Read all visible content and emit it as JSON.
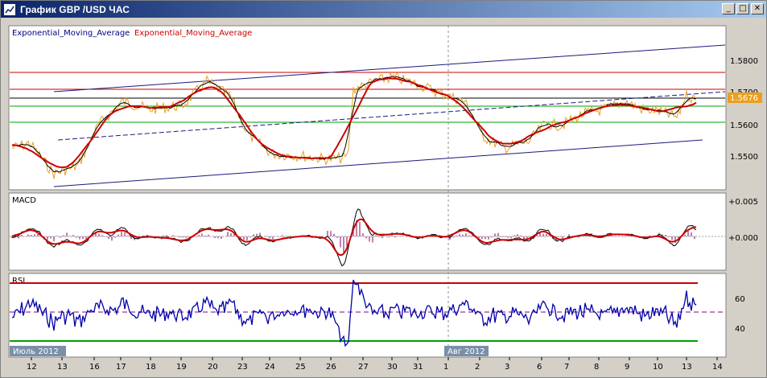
{
  "window": {
    "title": "График GBP /USD  ЧАС",
    "minimize_glyph": "_",
    "maximize_glyph": "□",
    "close_glyph": "✕",
    "icon": "chart-app-icon"
  },
  "colors": {
    "ema_fast": "#000000",
    "ema_slow": "#cc0000",
    "price": "#e8a020",
    "channel": "#1a1a7a",
    "level_red": "#cc0000",
    "level_green": "#00a000",
    "macd_hist": "#800060",
    "rsi_line": "#0000aa",
    "current_price_bg": "#e8a020"
  },
  "chart": {
    "legend_1": "Exponential_Moving_Average",
    "legend_2": "Exponential_Moving_Average",
    "current_price": "1.5676",
    "price_ticks": [
      "1.5800",
      "1.5700",
      "1.5600",
      "1.5500"
    ],
    "macd_title": "MACD",
    "macd_ticks": [
      "+0.005",
      "+0.000"
    ],
    "rsi_title": "RSI",
    "rsi_ticks": [
      "60",
      "40"
    ],
    "month_label_1": "Июль 2012",
    "month_label_2": "Авг 2012",
    "date_ticks": [
      "12",
      "13",
      "16",
      "17",
      "18",
      "19",
      "20",
      "23",
      "24",
      "25",
      "26",
      "27",
      "30",
      "31",
      "1",
      "2",
      "3",
      "6",
      "7",
      "8",
      "9",
      "10",
      "13",
      "14"
    ]
  }
}
